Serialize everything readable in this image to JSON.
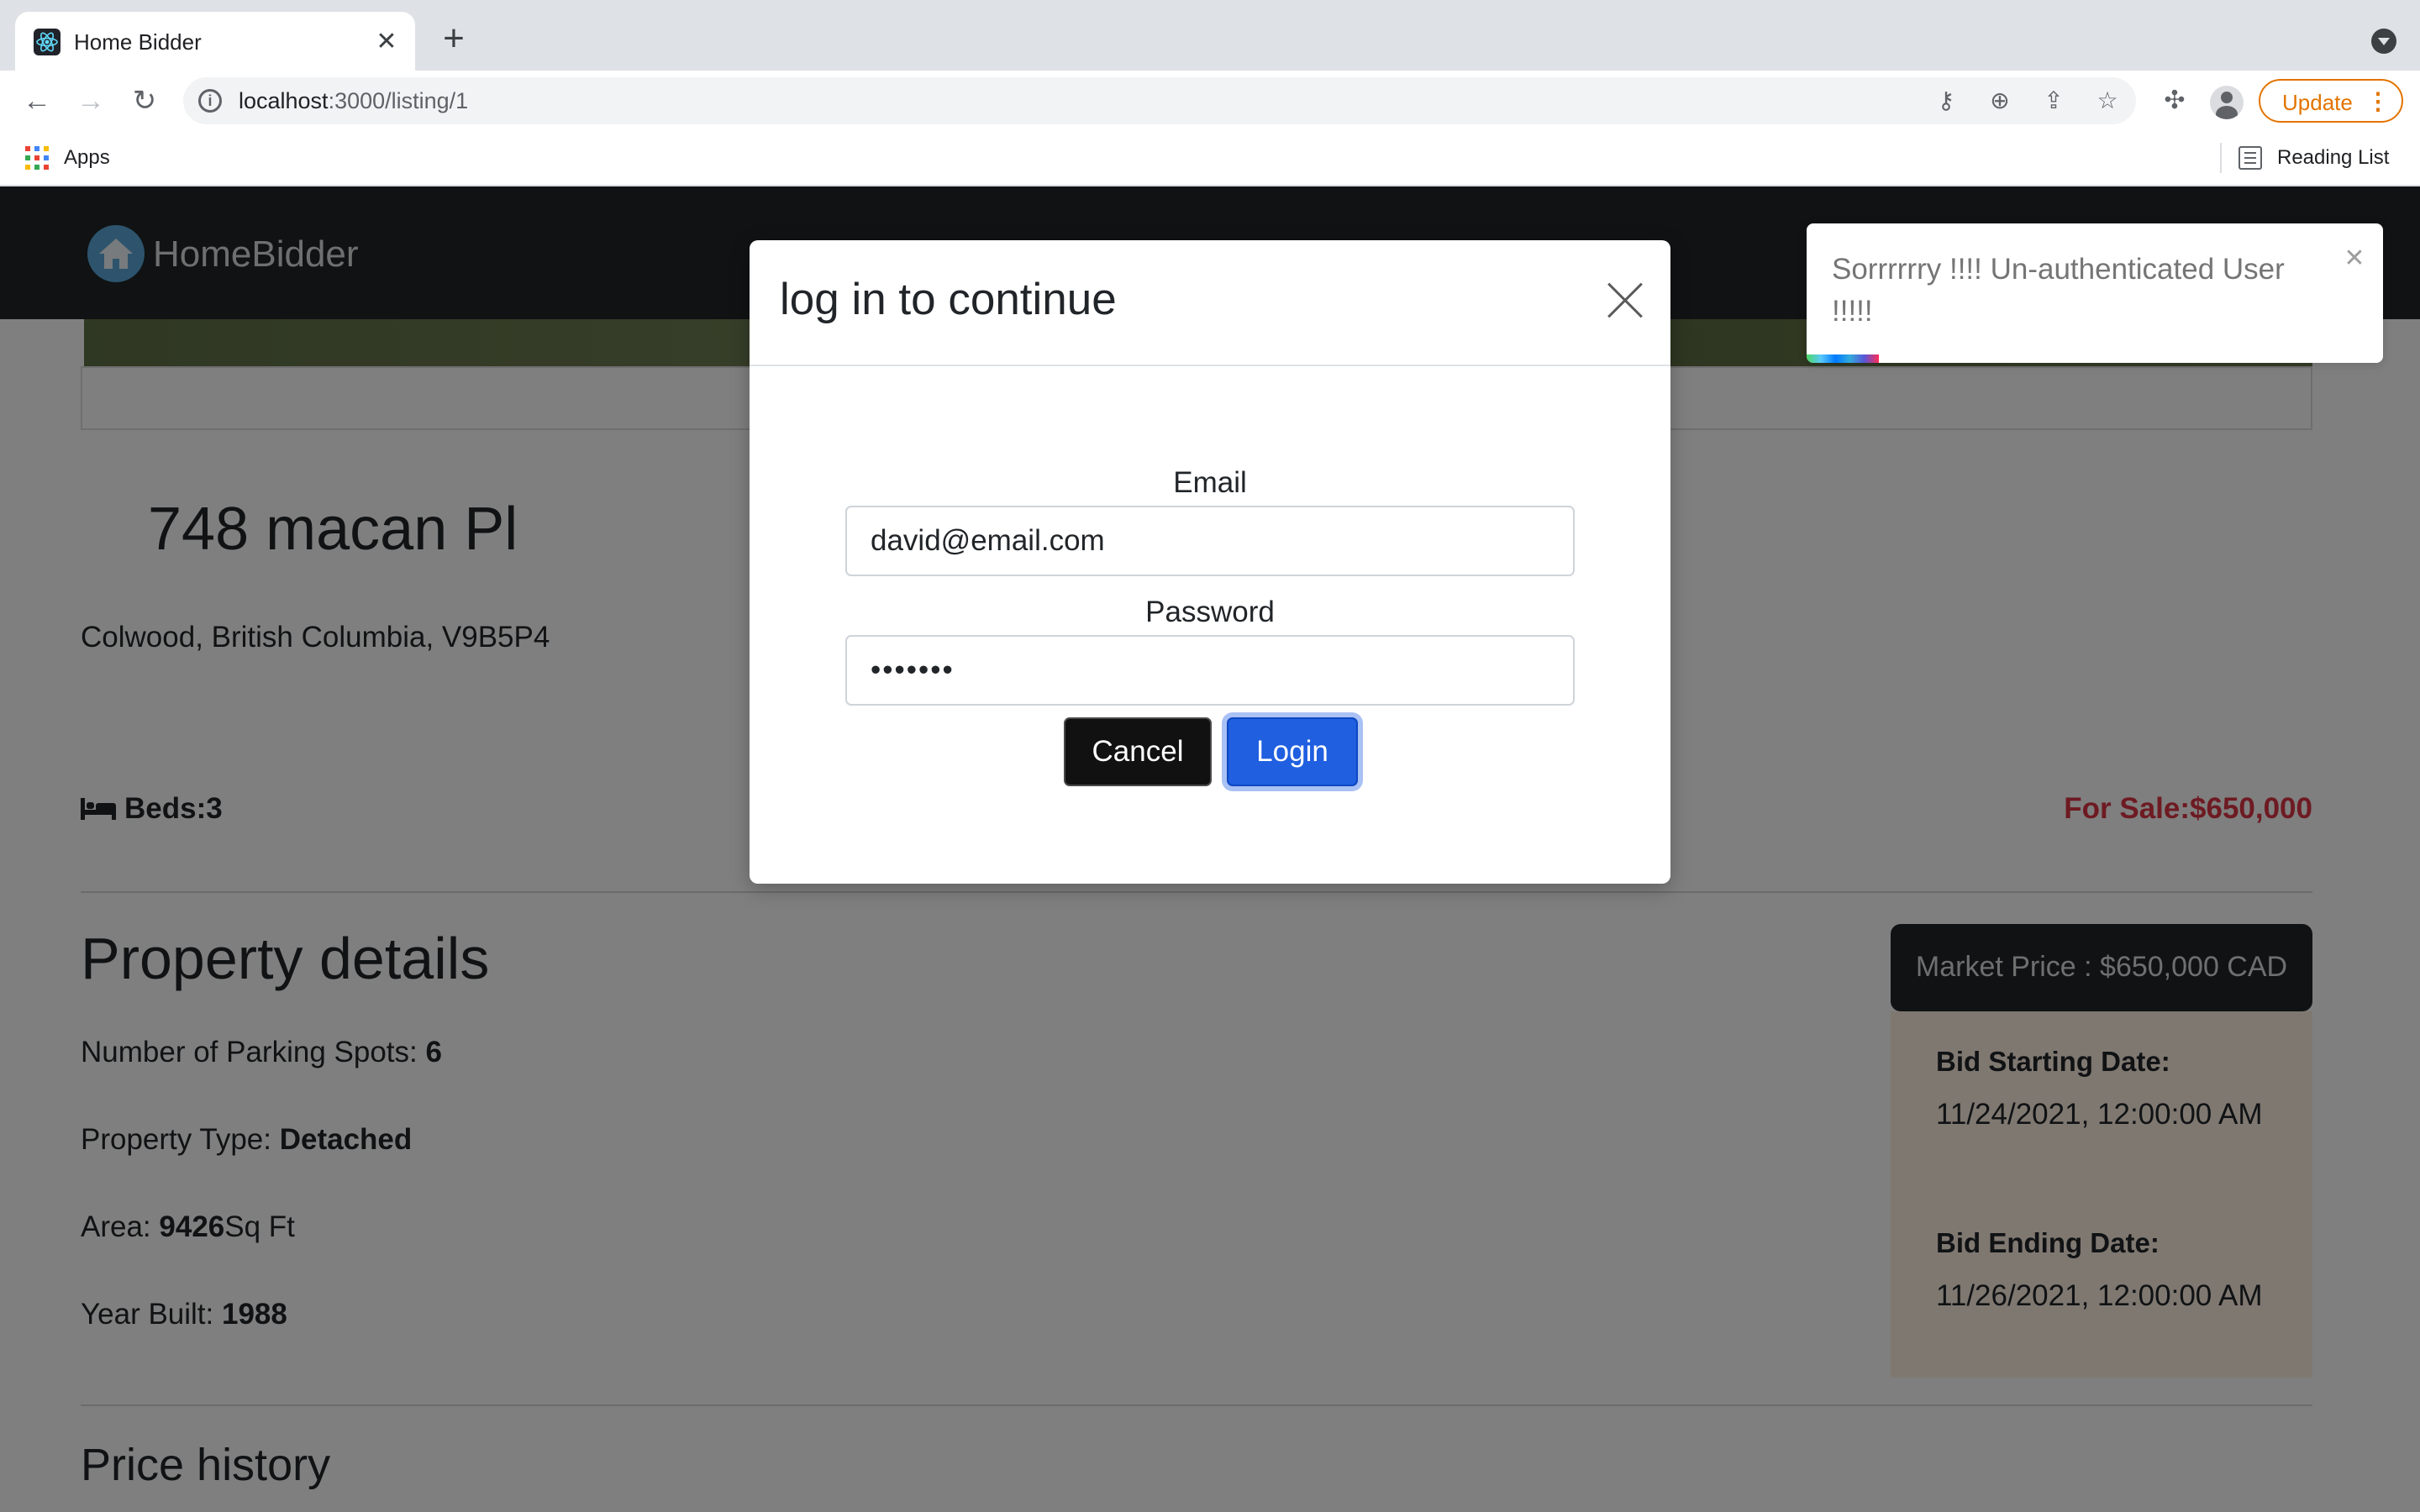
{
  "browser": {
    "tab_title": "Home Bidder",
    "tab_close": "✕",
    "new_tab": "+",
    "url_host": "localhost",
    "url_rest": ":3000/listing/1",
    "update_label": "Update",
    "bookmarks": {
      "apps_label": "Apps",
      "reading_list_label": "Reading List"
    }
  },
  "app": {
    "brand": "HomeBidder"
  },
  "listing": {
    "address": "748 macan Pl",
    "location": "Colwood, British Columbia, V9B5P4",
    "beds": "Beds:3",
    "for_sale": "For Sale:$650,000",
    "details_title": "Property details",
    "parking_label": "Number of Parking Spots: ",
    "parking_value": "6",
    "type_label": "Property Type: ",
    "type_value": "Detached",
    "area_label": "Area: ",
    "area_value": "9426",
    "area_unit": "Sq Ft",
    "year_label": "Year Built: ",
    "year_value": "1988",
    "market_price": "Market Price : $650,000 CAD",
    "bid_start_label": "Bid Starting Date:",
    "bid_start_value": "11/24/2021, 12:00:00 AM",
    "bid_end_label": "Bid Ending Date:",
    "bid_end_value": "11/26/2021, 12:00:00 AM",
    "price_history_title": "Price history"
  },
  "modal": {
    "title": "log in to continue",
    "email_label": "Email",
    "email_value": "david@email.com",
    "password_label": "Password",
    "password_value": "•••••••",
    "cancel_label": "Cancel",
    "login_label": "Login"
  },
  "toast": {
    "message": "Sorrrrrry !!!! Un-authenticated User !!!!!",
    "close": "✕"
  },
  "colors": {
    "navbar": "#212529",
    "sale_red": "#dc3545",
    "login_blue": "#1f5fe0",
    "bid_box": "#fff1e3",
    "update_orange": "#e37400"
  }
}
